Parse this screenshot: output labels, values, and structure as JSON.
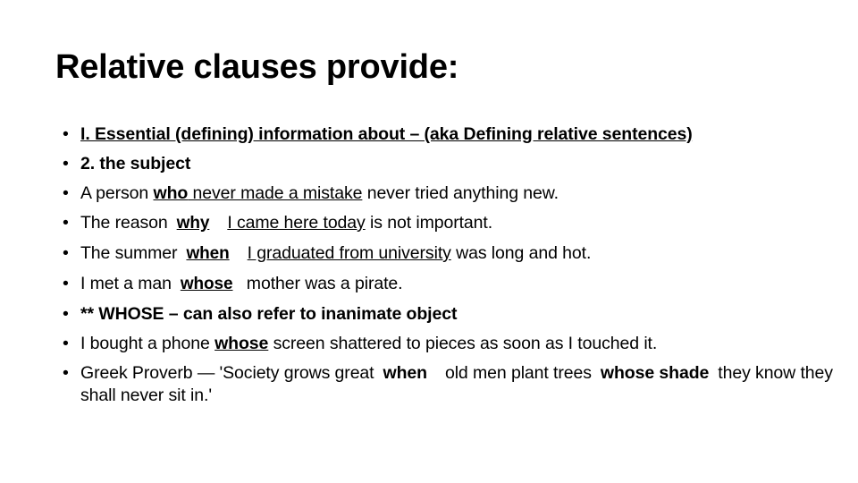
{
  "slide": {
    "title": "Relative clauses provide:",
    "background_color": "#ffffff",
    "text_color": "#000000",
    "bullet_glyph": "•"
  },
  "bullets": [
    {
      "id": "bullet-essential-info",
      "runs": [
        {
          "text": "I. Essential (defining) information about – (aka Defining relative sentences)",
          "style": "bold-underline"
        }
      ]
    },
    {
      "id": "bullet-the-subject",
      "runs": [
        {
          "text": "2. the subject",
          "style": "bold"
        }
      ]
    },
    {
      "id": "bullet-who-mistake",
      "runs": [
        {
          "text": "A person ",
          "style": "regular"
        },
        {
          "text": "who",
          "style": "bold-underline"
        },
        {
          "text": " never made a mistake",
          "style": "underline"
        },
        {
          "text": " never tried anything new.",
          "style": "regular"
        }
      ]
    },
    {
      "id": "bullet-why-came-here",
      "runs": [
        {
          "text": "The reason",
          "style": "regular"
        },
        {
          "text": "why",
          "style": "keyword"
        },
        {
          "text": "I came here today",
          "style": "underline-spaced"
        },
        {
          "text": " is not important.",
          "style": "regular"
        }
      ]
    },
    {
      "id": "bullet-when-graduated",
      "runs": [
        {
          "text": "The summer",
          "style": "regular"
        },
        {
          "text": "when",
          "style": "keyword"
        },
        {
          "text": "I graduated from university",
          "style": "underline-spaced"
        },
        {
          "text": " was long and hot.",
          "style": "regular"
        }
      ]
    },
    {
      "id": "bullet-whose-mother",
      "runs": [
        {
          "text": "I met a man",
          "style": "regular"
        },
        {
          "text": "whose",
          "style": "keyword"
        },
        {
          "text": " mother was a pirate.",
          "style": "regular"
        }
      ]
    },
    {
      "id": "bullet-whose-inanimate",
      "runs": [
        {
          "text": "** WHOSE – can also refer to inanimate object",
          "style": "bold"
        }
      ]
    },
    {
      "id": "bullet-phone-whose-screen",
      "runs": [
        {
          "text": "I bought a phone ",
          "style": "regular"
        },
        {
          "text": "whose",
          "style": "bold-underline"
        },
        {
          "text": " screen shattered to pieces as soon as I touched it.",
          "style": "regular"
        }
      ]
    },
    {
      "id": "bullet-greek-proverb",
      "runs": [
        {
          "text": "Greek Proverb — 'Society grows great",
          "style": "regular"
        },
        {
          "text": "when",
          "style": "bold-spaced"
        },
        {
          "text": "old men plant trees",
          "style": "regular-spaced"
        },
        {
          "text": "whose shade",
          "style": "bold-spaced"
        },
        {
          "text": "they know they shall never sit in.'",
          "style": "regular"
        }
      ]
    }
  ]
}
